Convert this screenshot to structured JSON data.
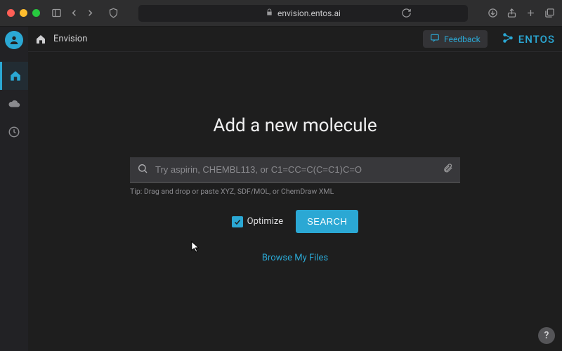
{
  "browser": {
    "url": "envision.entos.ai"
  },
  "topbar": {
    "app_name": "Envision",
    "feedback_label": "Feedback",
    "logo_text": "entos"
  },
  "content": {
    "headline": "Add a new molecule",
    "search_placeholder": "Try aspirin, CHEMBL113, or C1=CC=C(C=C1)C=O",
    "tip": "Tip: Drag and drop or paste XYZ, SDF/MOL, or ChemDraw XML",
    "optimize_label": "Optimize",
    "search_button": "SEARCH",
    "browse_label": "Browse My Files",
    "help_label": "?"
  },
  "colors": {
    "accent": "#2ba8d4"
  }
}
